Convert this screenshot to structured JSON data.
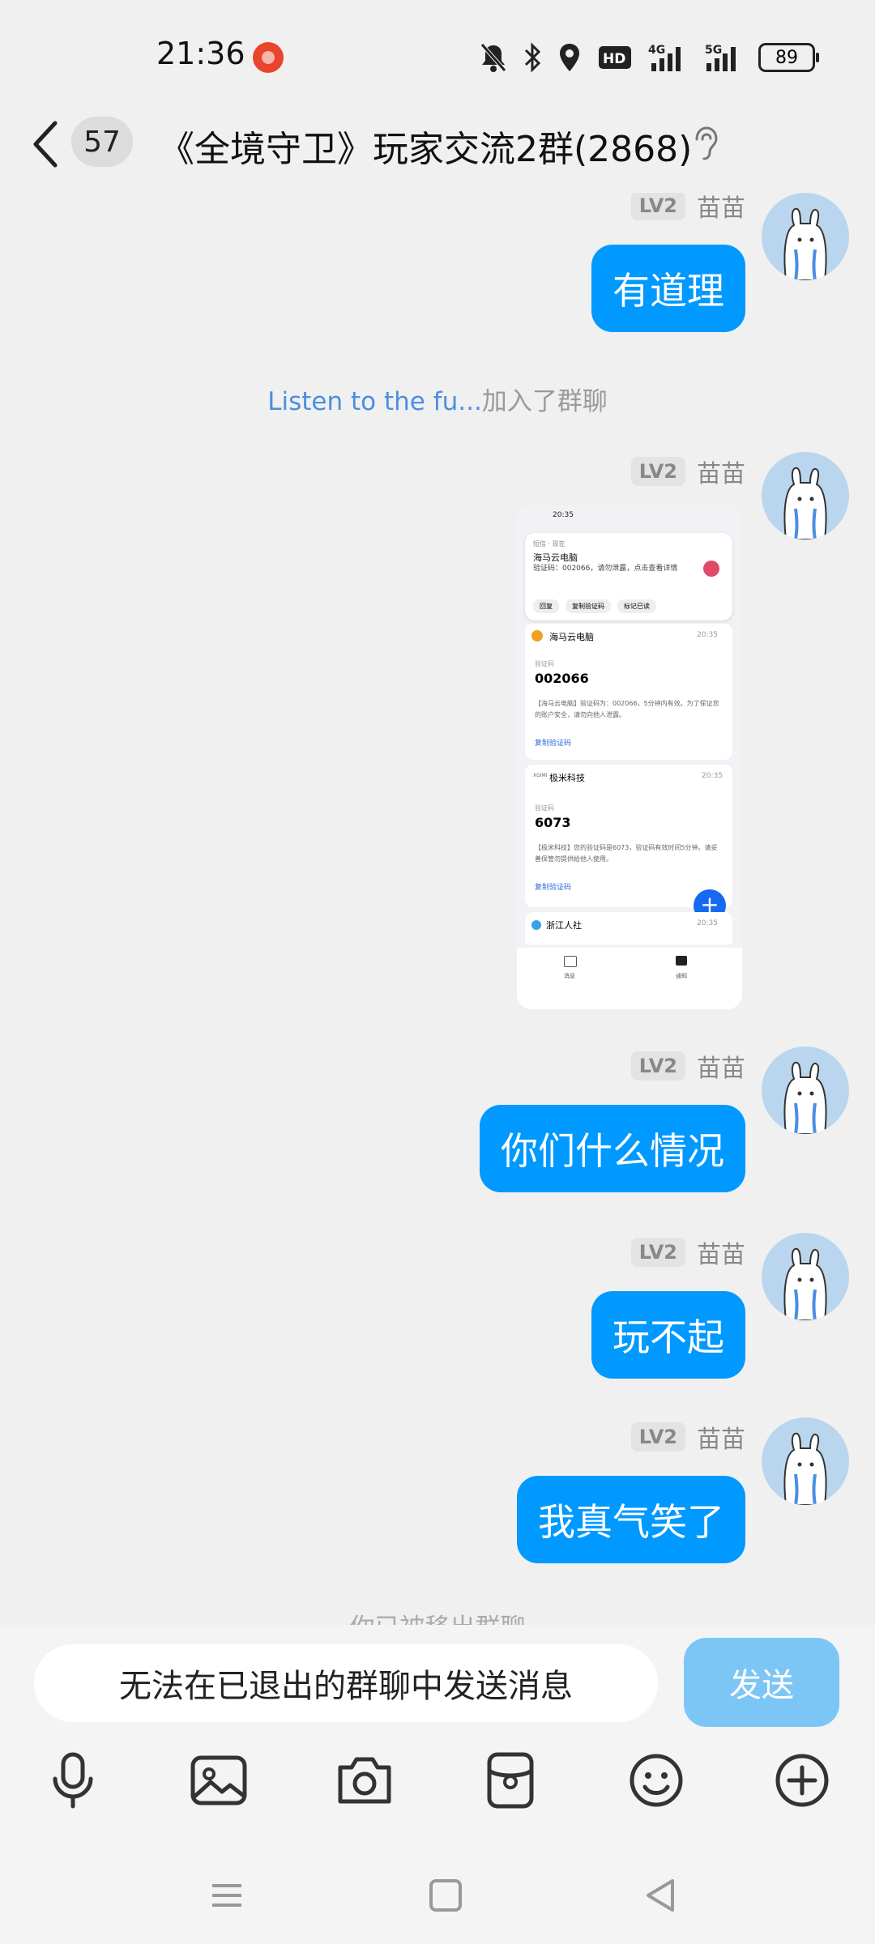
{
  "status_bar": {
    "time": "21:36",
    "network_label": "4G",
    "network2_label": "5G",
    "battery": "89",
    "icons": [
      "mute-bell-icon",
      "bluetooth-icon",
      "location-icon",
      "hd-icon",
      "signal-4g-icon",
      "signal-5g-icon",
      "battery-icon"
    ]
  },
  "header": {
    "unread_count": "57",
    "title": "《全境守卫》玩家交流2群(2868)"
  },
  "messages": [
    {
      "level": "LV2",
      "nickname": "苗苗",
      "text": "有道理"
    },
    {
      "system_link": "Listen to the fu...",
      "system_text": "加入了群聊"
    },
    {
      "level": "LV2",
      "nickname": "苗苗",
      "image": {
        "status_time": "20:35",
        "notif_app": "短信 · 现在",
        "notif_title": "海马云电脑",
        "notif_body": "验证码：002066，请勿泄露，点击查看详情",
        "notif_actions": [
          "回复",
          "复制验证码",
          "标记已读"
        ],
        "cards": [
          {
            "sender": "海马云电脑",
            "time": "20:35",
            "label": "验证码",
            "code": "002066",
            "body": "【海马云电脑】验证码为：002066，5分钟内有效。为了保证您的账户安全，请勿向他人泄露。",
            "action": "复制验证码"
          },
          {
            "sender": "极米科技",
            "time": "20:35",
            "label": "验证码",
            "code": "6073",
            "body": "【极米科技】您的验证码是6073，验证码有效时间5分钟。请妥善保管勿提供给他人使用。",
            "action": "复制验证码"
          },
          {
            "sender": "浙江人社",
            "time": "20:35"
          }
        ],
        "tab_msg": "消息",
        "tab_notif": "通知"
      }
    },
    {
      "level": "LV2",
      "nickname": "苗苗",
      "text": "你们什么情况"
    },
    {
      "level": "LV2",
      "nickname": "苗苗",
      "text": "玩不起"
    },
    {
      "level": "LV2",
      "nickname": "苗苗",
      "text": "我真气笑了"
    },
    {
      "system_partial": "你已被移出群聊"
    }
  ],
  "input": {
    "disabled_text": "无法在已退出的群聊中发送消息",
    "send_label": "发送"
  },
  "colors": {
    "bubble": "#0099ff",
    "send_disabled": "#7cc6f6",
    "background": "#f0f0f0",
    "link": "#4a8fe0"
  },
  "toolbar_icons": [
    "microphone-icon",
    "image-icon",
    "camera-icon",
    "red-packet-icon",
    "emoji-icon",
    "plus-icon"
  ],
  "nav_icons": [
    "menu-icon",
    "home-icon",
    "back-triangle-icon"
  ]
}
